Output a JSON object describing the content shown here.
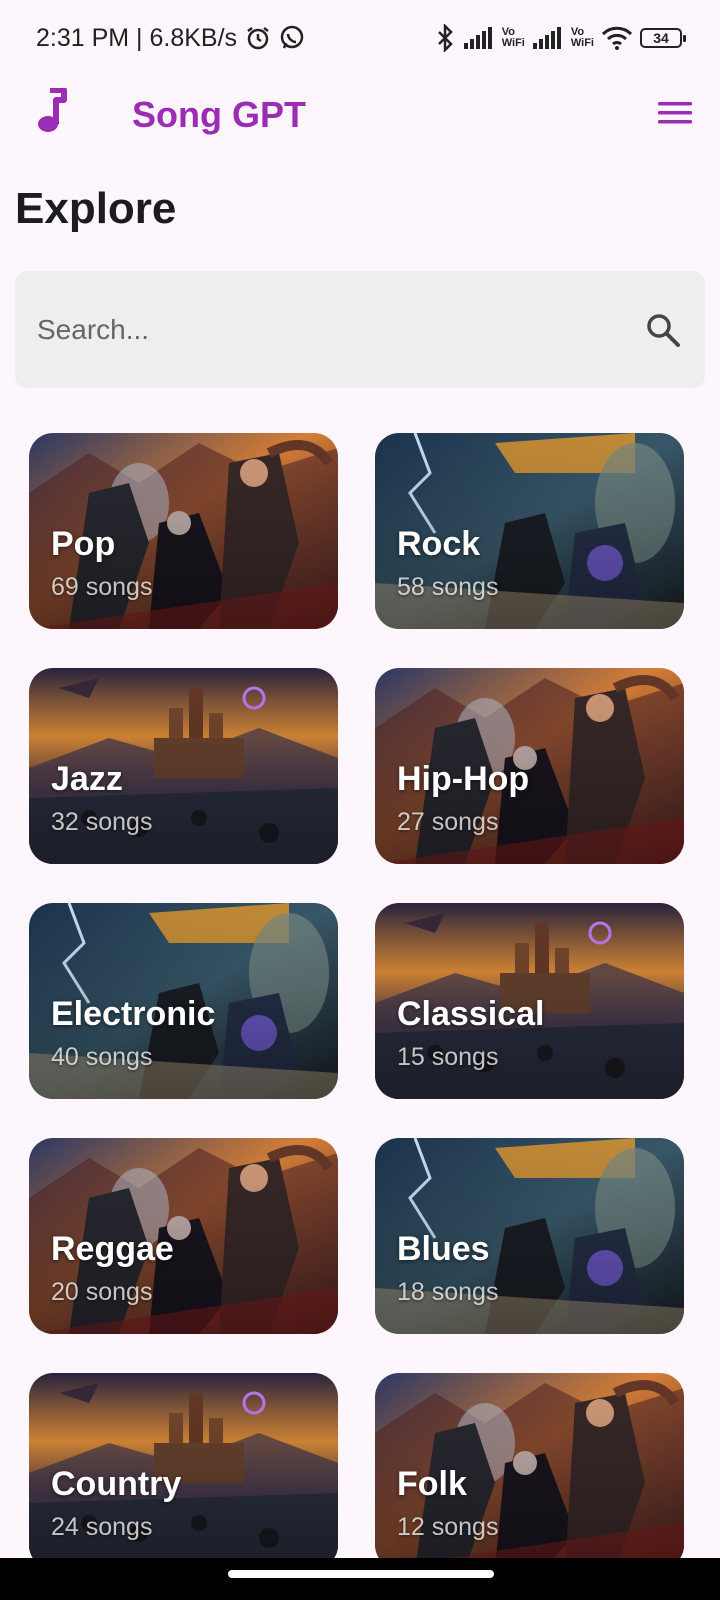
{
  "status_bar": {
    "time_speed": "2:31 PM | 6.8KB/s",
    "battery": "34",
    "sim1_label": "Vo\nWiFi",
    "sim2_label": "Vo\nWiFi"
  },
  "app": {
    "title": "Song GPT",
    "accent": "#9c2bb6"
  },
  "page": {
    "title": "Explore"
  },
  "search": {
    "placeholder": "Search..."
  },
  "genres": [
    {
      "name": "Pop",
      "count": "69 songs",
      "art": "warriors"
    },
    {
      "name": "Rock",
      "count": "58 songs",
      "art": "storm"
    },
    {
      "name": "Jazz",
      "count": "32 songs",
      "art": "castle"
    },
    {
      "name": "Hip-Hop",
      "count": "27 songs",
      "art": "warriors"
    },
    {
      "name": "Electronic",
      "count": "40 songs",
      "art": "storm"
    },
    {
      "name": "Classical",
      "count": "15 songs",
      "art": "castle"
    },
    {
      "name": "Reggae",
      "count": "20 songs",
      "art": "warriors"
    },
    {
      "name": "Blues",
      "count": "18 songs",
      "art": "storm"
    },
    {
      "name": "Country",
      "count": "24 songs",
      "art": "castle"
    },
    {
      "name": "Folk",
      "count": "12 songs",
      "art": "warriors"
    }
  ]
}
